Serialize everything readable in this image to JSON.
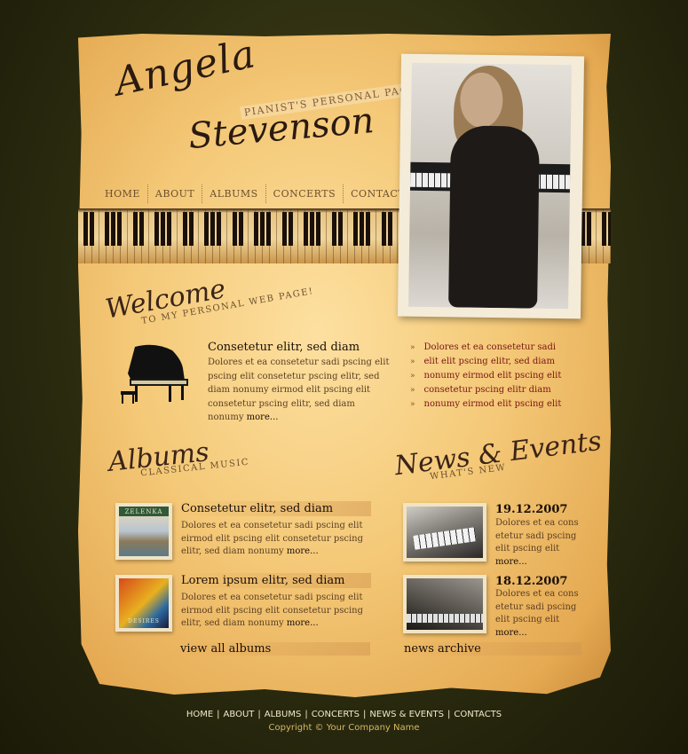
{
  "logo": {
    "first_name": "Angela",
    "last_name": "Stevenson",
    "tagline": "PIANIST'S PERSONAL PAGE"
  },
  "nav": [
    "HOME",
    "ABOUT",
    "ALBUMS",
    "CONCERTS",
    "CONTACTS"
  ],
  "welcome": {
    "heading": "Welcome",
    "subheading": "TO MY PERSONAL WEB PAGE!",
    "title": "Consetetur elitr, sed diam",
    "text": "Dolores et ea consetetur sadi pscing elit pscing elit consetetur pscing elitr, sed diam nonumy eirmod  elit pscing elit consetetur pscing elitr, sed diam nonumy",
    "more": "more...",
    "bullets": [
      "Dolores et ea consetetur sadi",
      "elit elit pscing elitr, sed diam",
      "nonumy eirmod  elit pscing elit",
      "consetetur pscing elitr diam",
      "nonumy eirmod  elit pscing elit"
    ],
    "bullet_marker": "»"
  },
  "albums": {
    "heading": "Albums",
    "subheading": "CLASSICAL MUSIC",
    "items": [
      {
        "cover_label": "ZELENKA",
        "title": "Consetetur elitr, sed diam",
        "text": "Dolores et ea consetetur sadi pscing elit eirmod  elit pscing elit consetetur pscing elitr, sed diam nonumy",
        "more": "more..."
      },
      {
        "cover_label": "DESIRES",
        "title": "Lorem  ipsum elitr, sed diam",
        "text": "Dolores et ea consetetur sadi pscing elit eirmod  elit pscing elit consetetur pscing elitr, sed diam nonumy",
        "more": "more..."
      }
    ],
    "view_all": "view all albums"
  },
  "news": {
    "heading": "News & Events",
    "subheading": "WHAT'S NEW",
    "items": [
      {
        "date": "19.12.2007",
        "text": "Dolores et ea cons etetur sadi pscing elit pscing elit",
        "more": "more..."
      },
      {
        "date": "18.12.2007",
        "text": "Dolores et ea cons etetur sadi pscing elit pscing elit",
        "more": "more..."
      }
    ],
    "archive": "news archive"
  },
  "footer": {
    "links": [
      "HOME",
      "ABOUT",
      "ALBUMS",
      "CONCERTS",
      "NEWS & EVENTS",
      "CONTACTS"
    ],
    "separator": "|",
    "copyright": "Copyright © Your Company Name"
  },
  "colors": {
    "background": "#2c2c10",
    "paper": "#f4c978",
    "bullet_text": "#7a1414",
    "footer_text": "#f0e8c8",
    "copyright_text": "#d8b860"
  }
}
